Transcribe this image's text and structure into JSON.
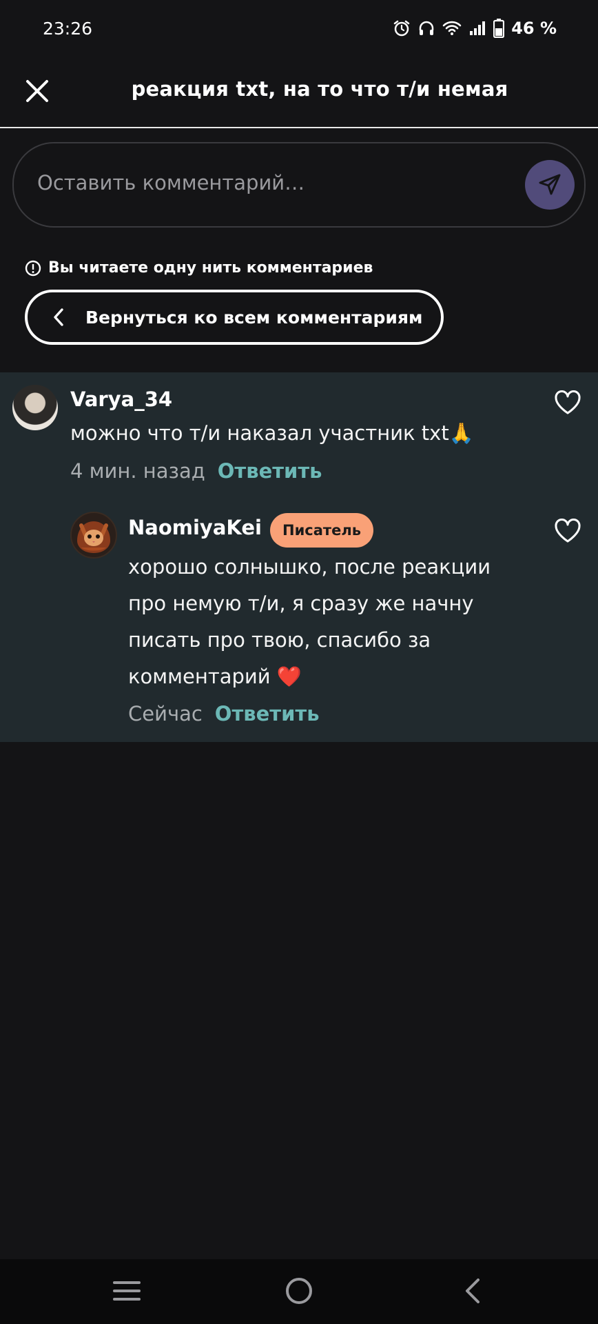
{
  "status": {
    "time": "23:26",
    "battery": "46 %"
  },
  "header": {
    "title": "реакция txt, на то что т/и немая"
  },
  "comment_input": {
    "placeholder": "Оставить комментарий…"
  },
  "thread_notice": "Вы читаете одну нить комментариев",
  "back_button_label": "Вернуться ко всем комментариям",
  "comments": [
    {
      "username": "Varya_34",
      "text": "можно что т/и наказал участник txt🙏",
      "time": "4 мин. назад",
      "reply_label": "Ответить"
    },
    {
      "username": "NaomiyaKei",
      "badge": "Писатель",
      "text_lines": [
        "хорошо солнышко, после реакции",
        "про немую т/и, я сразу же начну",
        "писать про твою, спасибо за",
        "комментарий ❤️"
      ],
      "time": "Сейчас",
      "reply_label": "Ответить"
    }
  ],
  "colors": {
    "accent": "#6cb8b6",
    "badge": "#f9a177",
    "send_button": "#514b7a",
    "thread_bg": "#212a2e"
  },
  "icons": [
    "alarm-icon",
    "headphones-icon",
    "wifi-icon",
    "signal-icon",
    "battery-icon",
    "close-icon",
    "send-icon",
    "info-icon",
    "chevron-left-icon",
    "heart-icon",
    "menu-icon",
    "home-icon",
    "back-icon"
  ]
}
